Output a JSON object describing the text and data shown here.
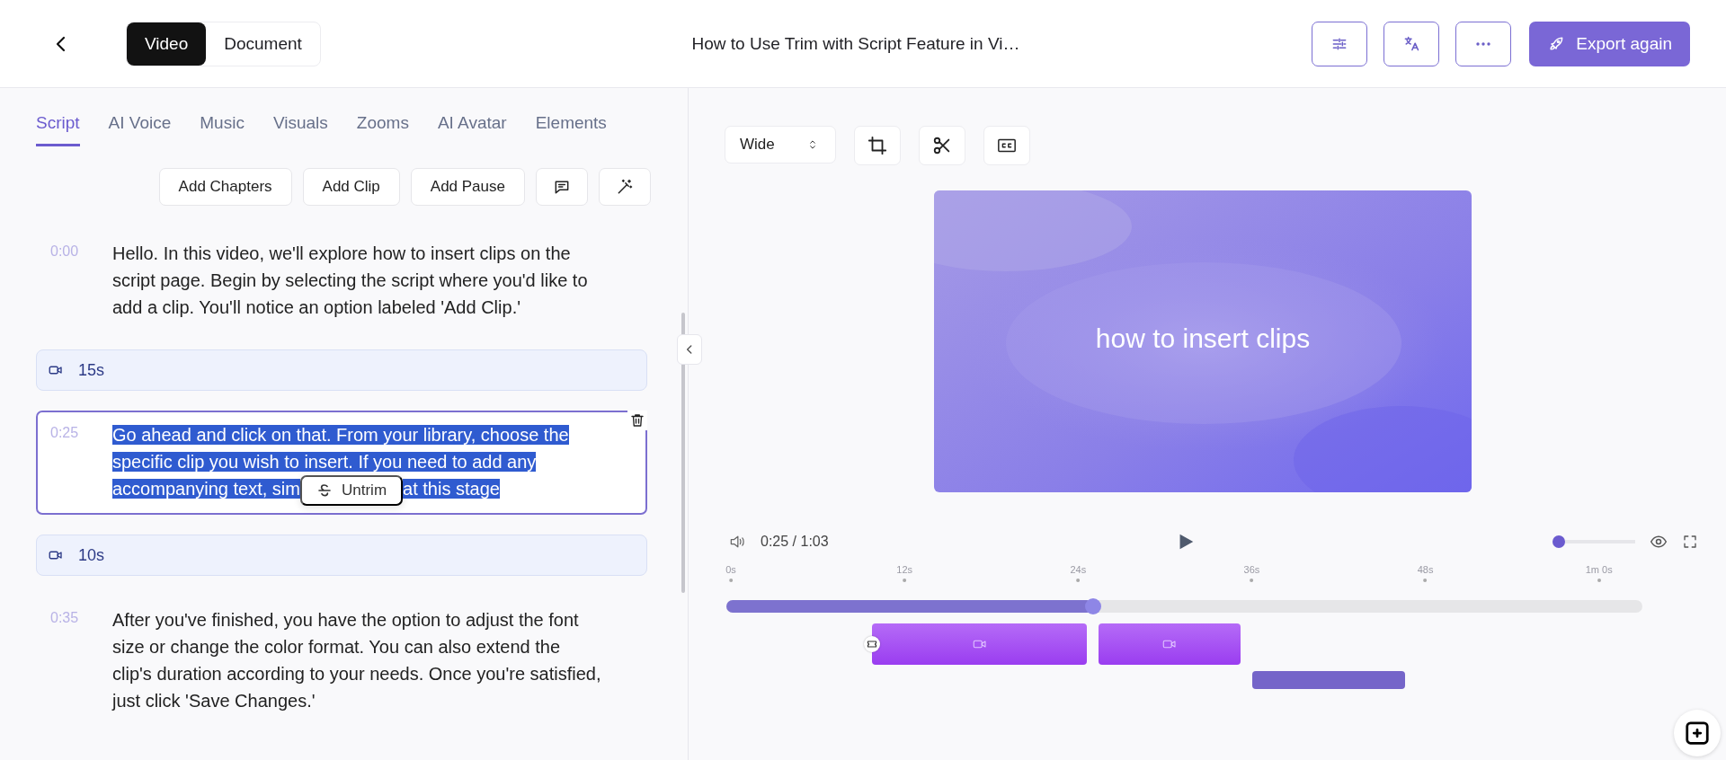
{
  "header": {
    "mode_tabs": [
      {
        "label": "Video",
        "selected": true
      },
      {
        "label": "Document",
        "selected": false
      }
    ],
    "title": "How to Use Trim with Script Feature in Vi…",
    "export_button": "Export again"
  },
  "editor_tabs": [
    {
      "label": "Script",
      "selected": true
    },
    {
      "label": "AI Voice",
      "selected": false
    },
    {
      "label": "Music",
      "selected": false
    },
    {
      "label": "Visuals",
      "selected": false
    },
    {
      "label": "Zooms",
      "selected": false
    },
    {
      "label": "AI Avatar",
      "selected": false
    },
    {
      "label": "Elements",
      "selected": false
    }
  ],
  "script_toolbar": [
    "Add Chapters",
    "Add Clip",
    "Add Pause"
  ],
  "script": [
    {
      "kind": "text",
      "selected": false,
      "time": "0:00",
      "text": "Hello. In this video, we'll explore how to insert clips on the script page. Begin by selecting the script where you'd like to add a clip. You'll notice an option labeled 'Add Clip.'"
    },
    {
      "kind": "clip",
      "selected": false,
      "duration": "15s"
    },
    {
      "kind": "text",
      "selected": true,
      "time": "0:25",
      "text": "Go ahead and click on that. From your library, choose the specific clip you wish to insert. If you need to add any accompanying text, sim",
      "popup": "Untrim",
      "text_after": "at this stage"
    },
    {
      "kind": "clip",
      "selected": false,
      "duration": "10s"
    },
    {
      "kind": "text",
      "selected": false,
      "time": "0:35",
      "text": "After you've finished, you have the option to adjust the font size or change the color format. You can also extend the clip's duration according to your needs. Once you're satisfied, just click 'Save Changes.'"
    }
  ],
  "preview": {
    "aspect": "Wide",
    "caption": "how to insert clips"
  },
  "player": {
    "time": "0:25 / 1:03",
    "volume": {
      "level": 0
    },
    "progress": {
      "level": 0.4
    }
  },
  "timeline_ticks": [
    "0s",
    "12s",
    "24s",
    "36s",
    "48s",
    "1m 0s"
  ]
}
